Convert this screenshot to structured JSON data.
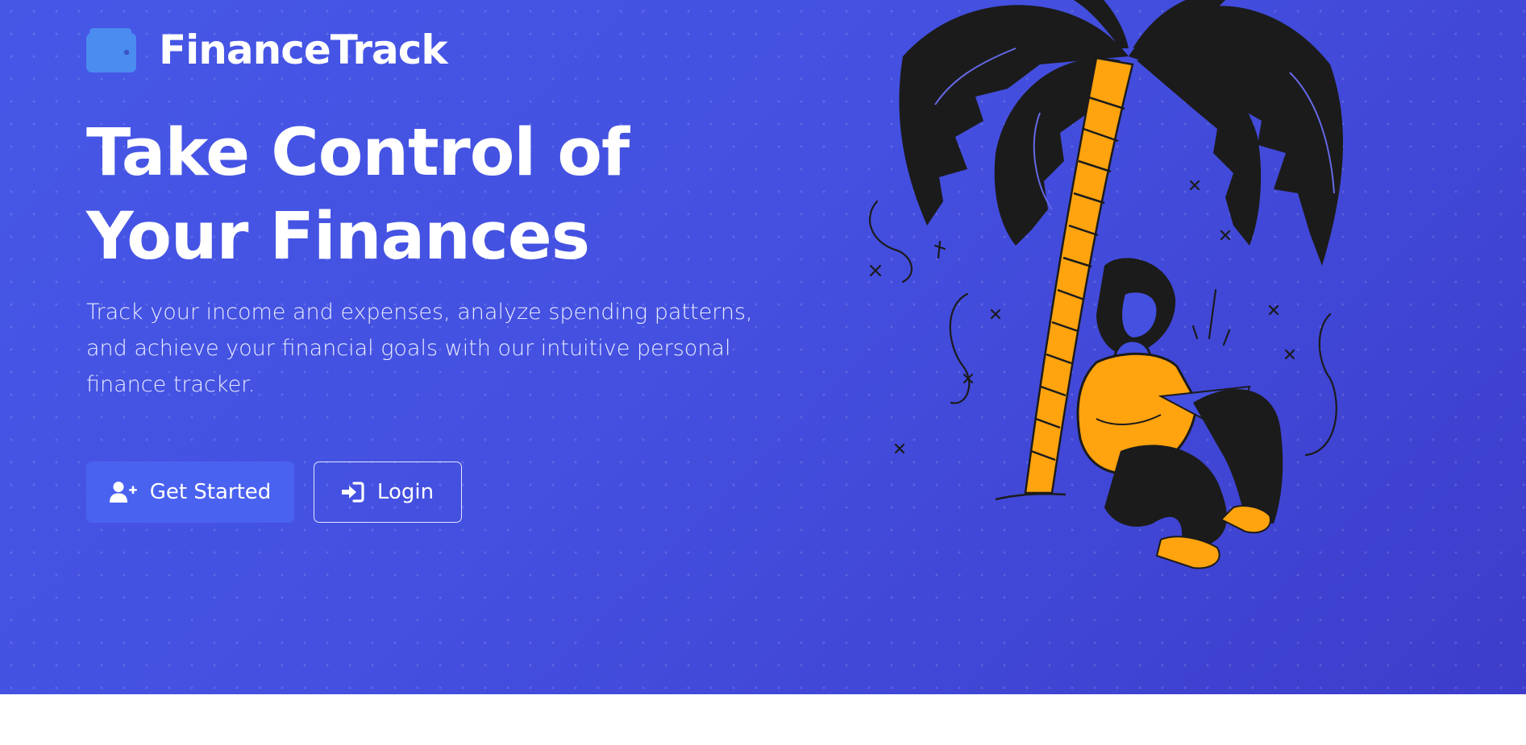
{
  "brand": {
    "name": "FinanceTrack",
    "icon": "wallet-icon"
  },
  "hero": {
    "headline": "Take Control of Your Finances",
    "subtitle": "Track your income and expenses, analyze spending patterns, and achieve your financial goals with our intuitive personal finance tracker.",
    "primary_button": {
      "label": "Get Started",
      "icon": "user-plus-icon"
    },
    "secondary_button": {
      "label": "Login",
      "icon": "sign-in-icon"
    }
  },
  "colors": {
    "hero_gradient_start": "#4657e6",
    "hero_gradient_end": "#3d3dcb",
    "primary_button": "#4a62f0",
    "brand_icon": "#4a8cf0",
    "illustration_accent": "#ffa30f",
    "illustration_dark": "#1a1a1a"
  }
}
